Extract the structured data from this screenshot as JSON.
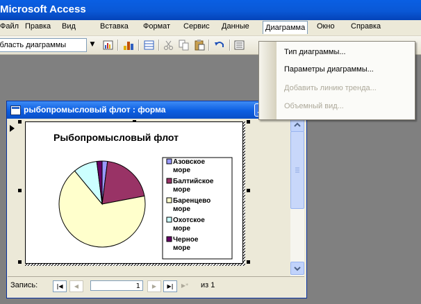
{
  "app": {
    "title": "Microsoft Access"
  },
  "menu": {
    "items": [
      "Файл",
      "Правка",
      "Вид",
      "Вставка",
      "Формат",
      "Сервис",
      "Данные",
      "Диаграмма",
      "Окно",
      "Справка"
    ],
    "selected": "Диаграмма"
  },
  "toolbar": {
    "object_selector_value": "Область диаграммы"
  },
  "dropdown": {
    "items": [
      {
        "label": "Тип диаграммы...",
        "enabled": true
      },
      {
        "label": "Параметры диаграммы...",
        "enabled": true
      },
      {
        "label": "Добавить линию тренда...",
        "enabled": false
      },
      {
        "label": "Объемный вид...",
        "enabled": false
      }
    ]
  },
  "form": {
    "title": "рыбопромысловый флот : форма",
    "nav": {
      "label": "Запись:",
      "current": "1",
      "of_label": "из 1"
    }
  },
  "chart_data": {
    "type": "pie",
    "title": "Рыбопромысловый флот",
    "categories": [
      "Азовское море",
      "Балтийское море",
      "Баренцево море",
      "Охотское море",
      "Черное море"
    ],
    "values": [
      2,
      20,
      67,
      9,
      2
    ],
    "colors": [
      "#9999ff",
      "#993366",
      "#ffffcc",
      "#ccffff",
      "#660066"
    ],
    "legend_position": "right"
  }
}
